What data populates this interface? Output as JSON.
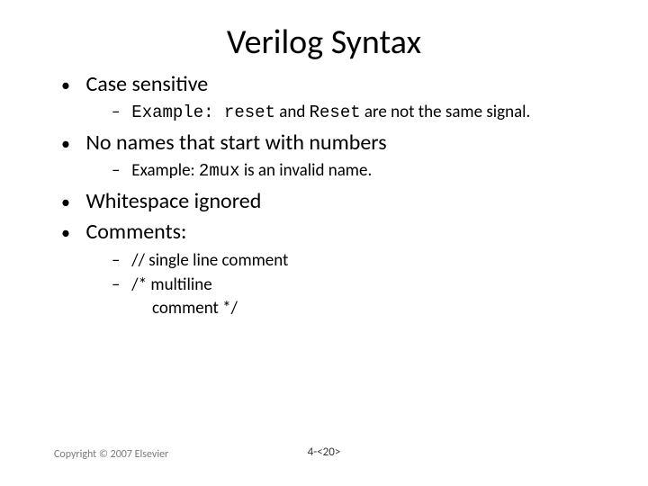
{
  "title": "Verilog Syntax",
  "bullets": {
    "b1": "Case sensitive",
    "b1s1_prefix": "Example: ",
    "b1s1_code1": "reset",
    "b1s1_mid": " and ",
    "b1s1_code2": "Reset",
    "b1s1_suffix": " are not the same signal.",
    "b2": "No names that start with numbers",
    "b2s1_prefix": "Example: ",
    "b2s1_code": "2mux",
    "b2s1_suffix": " is an invalid name.",
    "b3": "Whitespace ignored",
    "b4": "Comments:",
    "b4s1": "// single line comment",
    "b4s2a": "/* multiline",
    "b4s2b": "comment */"
  },
  "footer": {
    "copyright": "Copyright © 2007 Elsevier",
    "pagenum": "4-<20>"
  }
}
